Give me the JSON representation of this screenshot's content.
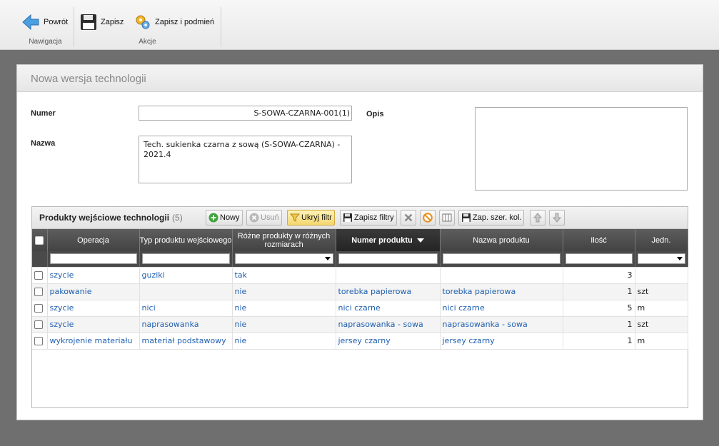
{
  "ribbon": {
    "back_label": "Powrót",
    "save_label": "Zapisz",
    "save_replace_label": "Zapisz i podmień",
    "nav_caption": "Nawigacja",
    "actions_caption": "Akcje"
  },
  "panel": {
    "title": "Nowa wersja technologii"
  },
  "form": {
    "number_label": "Numer",
    "number_value": "S-SOWA-CZARNA-001(1)",
    "name_label": "Nazwa",
    "name_value": "Tech. sukienka czarna z sową (S-SOWA-CZARNA) - 2021.4",
    "description_label": "Opis",
    "description_value": ""
  },
  "grid": {
    "title": "Produkty wejściowe technologii",
    "count": "(5)",
    "toolbar": {
      "new": "Nowy",
      "delete": "Usuń",
      "hide_filter": "Ukryj filtr",
      "save_filters": "Zapisz filtry",
      "save_col_width": "Zap. szer. kol."
    },
    "columns": [
      "Operacja",
      "Typ produktu wejściowego",
      "Różne produkty w różnych rozmiarach",
      "Numer produktu",
      "Nazwa produktu",
      "Ilość",
      "Jedn."
    ],
    "rows": [
      {
        "operation": "szycie",
        "type": "guziki",
        "sizes": "tak",
        "product_number": "",
        "product_name": "",
        "quantity": "3",
        "unit": ""
      },
      {
        "operation": "pakowanie",
        "type": "",
        "sizes": "nie",
        "product_number": "torebka papierowa",
        "product_name": "torebka papierowa",
        "quantity": "1",
        "unit": "szt"
      },
      {
        "operation": "szycie",
        "type": "nici",
        "sizes": "nie",
        "product_number": "nici czarne",
        "product_name": "nici czarne",
        "quantity": "5",
        "unit": "m"
      },
      {
        "operation": "szycie",
        "type": "naprasowanka",
        "sizes": "nie",
        "product_number": "naprasowanka - sowa",
        "product_name": "naprasowanka - sowa",
        "quantity": "1",
        "unit": "szt"
      },
      {
        "operation": "wykrojenie materiału",
        "type": "materiał podstawowy",
        "sizes": "nie",
        "product_number": "jersey czarny",
        "product_name": "jersey czarny",
        "quantity": "1",
        "unit": "m"
      }
    ]
  },
  "colors": {
    "link": "#1f5fb0",
    "header_dark": "#4a4a4a",
    "active_filter": "#f5d76e"
  }
}
